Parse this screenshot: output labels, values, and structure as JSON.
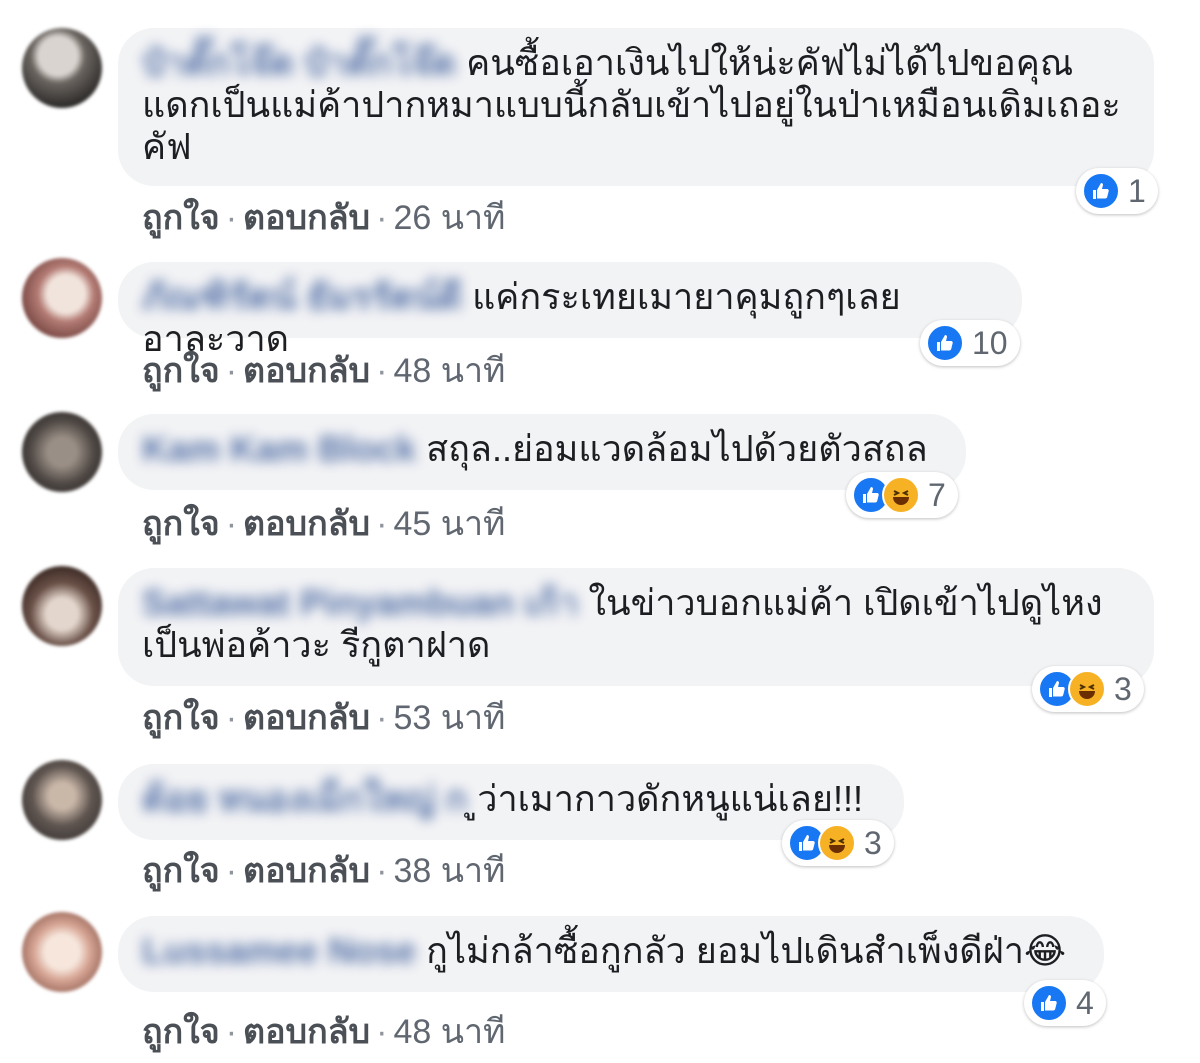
{
  "colors": {
    "like": "#1877f2",
    "haha": "#f7b125",
    "bubble": "#f2f3f5",
    "author": "#385898"
  },
  "actions": {
    "like": "ถูกใจ",
    "reply": "ตอบกลับ",
    "dot": "·"
  },
  "comments": [
    {
      "author": "ป๋าตั๊กโจ๊ด ป๋าตั๊กโจ๊ด",
      "text": "คนซื้อเอาเงินไปให้น่ะคัฟไม่ได้ไปขอคุณแดกเป็นแม่ค้าปากหมาแบบนี้กลับเข้าไปอยู่ในป่าเหมือนเดิมเถอะคัฟ",
      "time": "26 นาที",
      "reactions": [
        "like-icon"
      ],
      "count": "1"
    },
    {
      "author": "ภัณฑิรัตน์ ธัมรรัตน์ดี",
      "text": "แค่กระเทยเมายาคุมถูกๆเลยอาละวาด",
      "time": "48 นาที",
      "reactions": [
        "like-icon"
      ],
      "count": "10"
    },
    {
      "author": "Kam Kam Block",
      "text": "สถุล..ย่อมแวดล้อมไปด้วยตัวสถล",
      "time": "45 นาที",
      "reactions": [
        "like-icon",
        "haha-icon"
      ],
      "count": "7"
    },
    {
      "author": "Sattawat Pinyambuan เก้า",
      "text": "ในข่าวบอกแม่ค้า เปิดเข้าไปดูไหงเป็นพ่อค้าวะ รีกูตาฝาด",
      "time": "53 นาที",
      "reactions": [
        "like-icon",
        "haha-icon"
      ],
      "count": "3"
    },
    {
      "author": "ต้อย หนองเม็กใหญ่ ก",
      "text": "ูว่าเมากาวดักหนูแน่เลย!!!",
      "time": "38 นาที",
      "reactions": [
        "like-icon",
        "haha-icon"
      ],
      "count": "3"
    },
    {
      "author": "Lussamee Nose",
      "text": "กูไม่กล้าซื้อกูกลัว ยอมไปเดินสำเพ็งดีฝ่า😂",
      "time": "48 นาที",
      "reactions": [
        "like-icon"
      ],
      "count": "4"
    }
  ]
}
